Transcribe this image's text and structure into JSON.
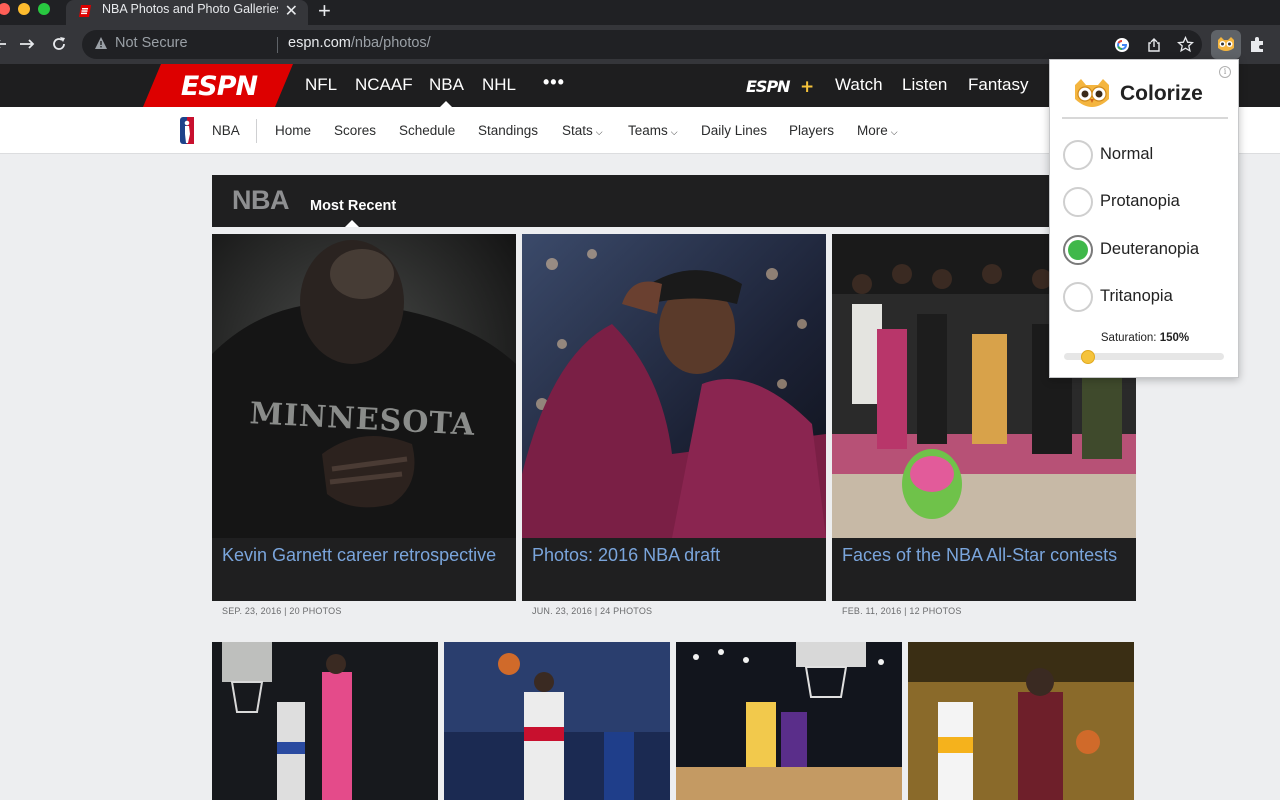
{
  "browser": {
    "tab_title": "NBA Photos and Photo Galleries",
    "tab_close": "✕",
    "new_tab": "+",
    "not_secure": "Not Secure",
    "url_host": "espn.com",
    "url_path": "/nba/photos/"
  },
  "espn_nav": {
    "items": [
      "NFL",
      "NCAAF",
      "NBA",
      "NHL"
    ],
    "more": "•••",
    "espn_plus": "ESPN+",
    "watch": "Watch",
    "listen": "Listen",
    "fantasy": "Fantasy"
  },
  "sub_nav": {
    "league": "NBA",
    "items": [
      "Home",
      "Scores",
      "Schedule",
      "Standings",
      "Stats",
      "Teams",
      "Daily Lines",
      "Players",
      "More"
    ]
  },
  "gallery": {
    "title": "NBA",
    "tab": "Most Recent",
    "cards": [
      {
        "title": "Kevin Garnett career retrospective",
        "meta": "SEP. 23, 2016 | 20 PHOTOS"
      },
      {
        "title": "Photos: 2016 NBA draft",
        "meta": "JUN. 23, 2016 | 24 PHOTOS"
      },
      {
        "title": "Faces of the NBA All-Star contests",
        "meta": "FEB. 11, 2016 | 12 PHOTOS"
      }
    ],
    "jersey_text": "MINNESOTA"
  },
  "colorize": {
    "title": "Colorize",
    "info": "i",
    "options": [
      {
        "label": "Normal",
        "selected": false
      },
      {
        "label": "Protanopia",
        "selected": false
      },
      {
        "label": "Deuteranopia",
        "selected": true
      },
      {
        "label": "Tritanopia",
        "selected": false
      }
    ],
    "saturation_label": "Saturation:",
    "saturation_value": "150%",
    "saturation_level": 0.15
  },
  "colors": {
    "espn_red": "#d00",
    "link_blue": "#7aa5dc",
    "radio_green": "#3fb84a",
    "slider_yellow": "#f5c33b"
  }
}
